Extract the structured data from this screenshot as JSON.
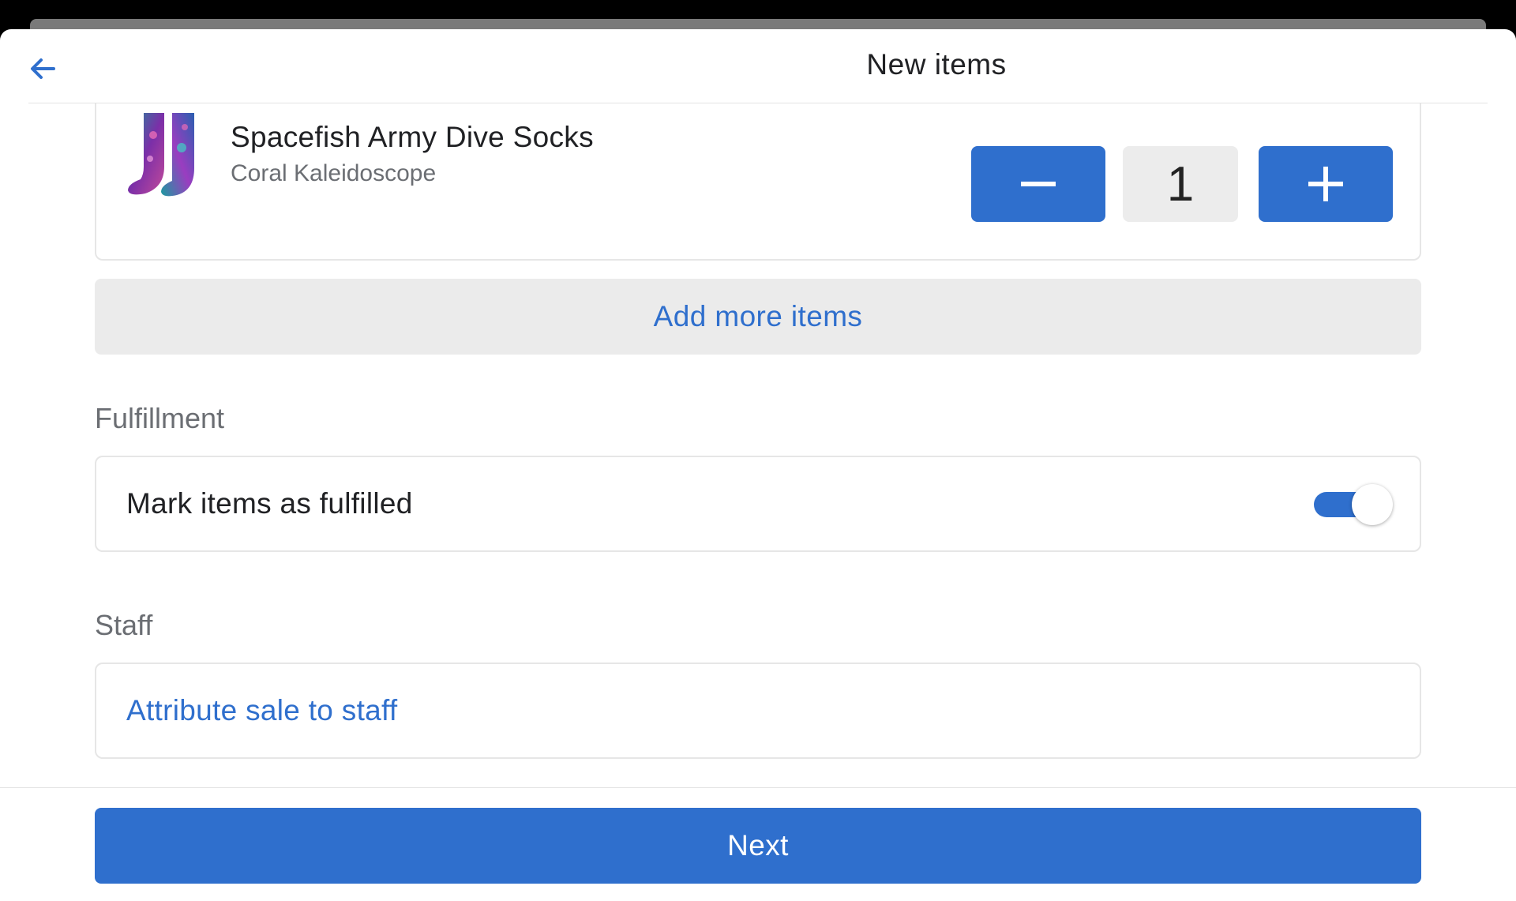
{
  "header": {
    "title": "New items",
    "back_icon": "arrow-left-icon"
  },
  "item": {
    "name": "Spacefish Army Dive Socks",
    "variant": "Coral Kaleidoscope",
    "quantity": "1",
    "minus_icon": "minus-icon",
    "plus_icon": "plus-icon"
  },
  "actions": {
    "add_more_label": "Add more items",
    "next_label": "Next"
  },
  "fulfillment": {
    "section_label": "Fulfillment",
    "toggle_label": "Mark items as fulfilled",
    "toggle_on": true
  },
  "staff": {
    "section_label": "Staff",
    "attribute_label": "Attribute sale to staff"
  },
  "colors": {
    "accent": "#2f6fcd",
    "muted_bg": "#ebebeb",
    "text": "#202124",
    "secondary_text": "#6b6e73"
  }
}
